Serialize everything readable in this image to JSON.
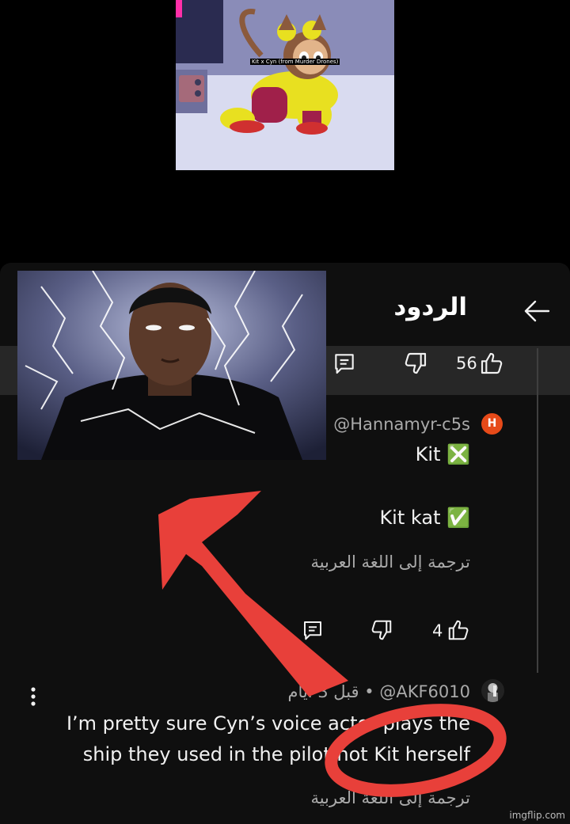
{
  "meme": {
    "thumbnail_caption": "Kit x Cyn (from Murder Drones)",
    "watermark": "imgflip.com"
  },
  "header": {
    "title": "الردود",
    "back_icon": "arrow-right-icon"
  },
  "parent_comment": {
    "likes": "56",
    "icons": [
      "thumbs-up-icon",
      "thumbs-down-icon",
      "reply-icon"
    ]
  },
  "replies": [
    {
      "avatar_letter": "H",
      "avatar_color": "#e64a19",
      "handle": "@Hannamyr-c5s",
      "meta": "•",
      "lines": [
        "Kit ❎",
        "Kit kat ✅"
      ],
      "translate": "ترجمة إلى اللغة العربية",
      "likes": "4"
    },
    {
      "handle": "@AKF6010",
      "meta": "قبل 3 أيام •",
      "lines": [
        "I’m pretty sure Cyn’s voice actor plays the",
        "ship they used in the pilot not Kit herself"
      ],
      "translate": "ترجمة إلى اللغة العربية"
    }
  ],
  "colors": {
    "panel_bg": "#0f0f0f",
    "band_bg": "#272727",
    "annotation_red": "#e8403a"
  }
}
